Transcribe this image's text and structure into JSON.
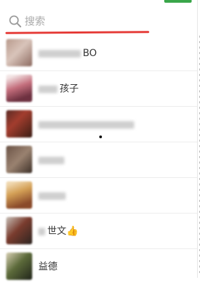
{
  "search": {
    "placeholder": "搜索",
    "value": ""
  },
  "icons": {
    "search": "search-icon"
  },
  "colors": {
    "underline": "#e53935",
    "accent": "#3aa64a"
  },
  "contacts": [
    {
      "visible_text": "BO"
    },
    {
      "visible_text": "孩子"
    },
    {
      "visible_text": ""
    },
    {
      "visible_text": ""
    },
    {
      "visible_text": ""
    },
    {
      "visible_text": "世文"
    },
    {
      "visible_text": "益德"
    }
  ]
}
